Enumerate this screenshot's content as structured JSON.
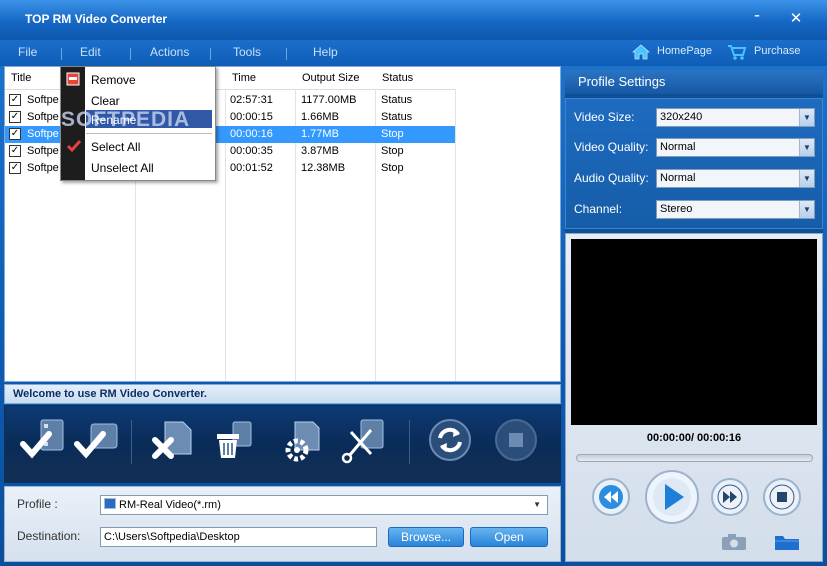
{
  "window": {
    "title": "TOP RM Video Converter",
    "minimize": "–",
    "close": "✕"
  },
  "menu": {
    "items": [
      "File",
      "Edit",
      "Actions",
      "Tools",
      "Help"
    ],
    "homepage": "HomePage",
    "purchase": "Purchase"
  },
  "list": {
    "headers": [
      "Title",
      "Time",
      "Output Size",
      "Status"
    ],
    "rows": [
      {
        "checked": true,
        "title": "Softpe",
        "time": "02:57:31",
        "size": "1177.00MB",
        "status": "Status",
        "selected": false
      },
      {
        "checked": true,
        "title": "Softpe",
        "time": "00:00:15",
        "size": "1.66MB",
        "status": "Status",
        "selected": false
      },
      {
        "checked": true,
        "title": "Softpe",
        "time": "00:00:16",
        "size": "1.77MB",
        "status": "Stop",
        "selected": true
      },
      {
        "checked": true,
        "title": "Softpe",
        "time": "00:00:35",
        "size": "3.87MB",
        "status": "Stop",
        "selected": false
      },
      {
        "checked": true,
        "title": "Softpe",
        "time": "00:01:52",
        "size": "12.38MB",
        "status": "Stop",
        "selected": false
      }
    ]
  },
  "context_menu": {
    "items": [
      "Remove",
      "Clear",
      "Rename",
      "Select All",
      "Unselect All"
    ],
    "watermark": "SOFTPEDIA"
  },
  "status": {
    "message": "Welcome to use RM Video Converter."
  },
  "output": {
    "profile_label": "Profile :",
    "profile_value": "RM-Real Video(*.rm)",
    "destination_label": "Destination:",
    "destination_value": "C:\\Users\\Softpedia\\Desktop",
    "browse": "Browse...",
    "open": "Open"
  },
  "profile_settings": {
    "title": "Profile  Settings",
    "video_size_label": "Video  Size:",
    "video_size": "320x240",
    "video_quality_label": "Video  Quality:",
    "video_quality": "Normal",
    "audio_quality_label": "Audio  Quality:",
    "audio_quality": "Normal",
    "channel_label": "Channel:",
    "channel": "Stereo"
  },
  "player": {
    "time": "00:00:00/ 00:00:16"
  }
}
